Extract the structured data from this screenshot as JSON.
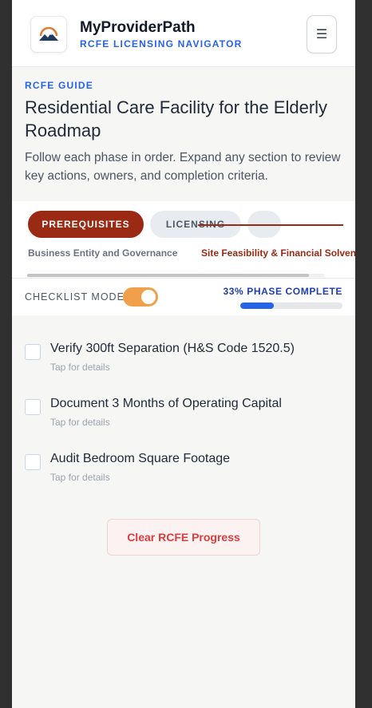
{
  "header": {
    "brand_title": "MyProviderPath",
    "brand_subtitle": "RCFE LICENSING NAVIGATOR",
    "menu_icon": "☰"
  },
  "intro": {
    "eyebrow": "RCFE GUIDE",
    "title": "Residential Care Facility for the Elderly Roadmap",
    "description": "Follow each phase in order. Expand any section to review key actions, owners, and completion criteria."
  },
  "phases": {
    "active": "PREREQUISITES",
    "next": "LICENSING"
  },
  "subtabs": {
    "first": "Business Entity and Governance",
    "second": "Site Feasibility & Financial Solvency"
  },
  "controls": {
    "checklist_label": "CHECKLIST MODE",
    "checklist_on": true,
    "progress_label": "33% PHASE COMPLETE",
    "progress_fraction": 0.33
  },
  "checklist": [
    {
      "title": "Verify 300ft Separation (H&S Code 1520.5)",
      "hint": "Tap for details"
    },
    {
      "title": "Document 3 Months of Operating Capital",
      "hint": "Tap for details"
    },
    {
      "title": "Audit Bedroom Square Footage",
      "hint": "Tap for details"
    }
  ],
  "clear_button": "Clear RCFE Progress",
  "colors": {
    "accent_red": "#9a2a14",
    "accent_blue": "#2563eb",
    "toggle_orange": "#f0a04b",
    "danger": "#dc3c3c"
  }
}
